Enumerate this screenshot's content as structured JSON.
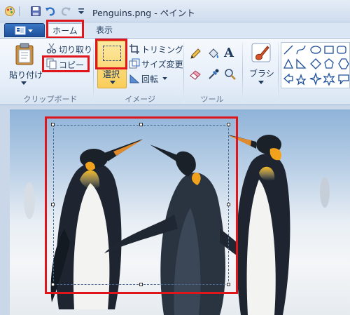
{
  "window": {
    "title": "Penguins.png - ペイント"
  },
  "tabs": [
    {
      "label": "ホーム"
    },
    {
      "label": "表示"
    }
  ],
  "ribbon": {
    "clipboard": {
      "paste_label": "貼り付け",
      "cut_label": "切り取り",
      "copy_label": "コピー",
      "group_label": "クリップボード"
    },
    "image": {
      "select_label": "選択",
      "crop_label": "トリミング",
      "resize_label": "サイズ変更",
      "rotate_label": "回転",
      "group_label": "イメージ"
    },
    "tools": {
      "group_label": "ツール",
      "text_tool": "A"
    },
    "brushes": {
      "label": "ブラシ"
    }
  },
  "colors": {
    "highlight": "#e0161d",
    "accent": "#1e4f9b"
  }
}
